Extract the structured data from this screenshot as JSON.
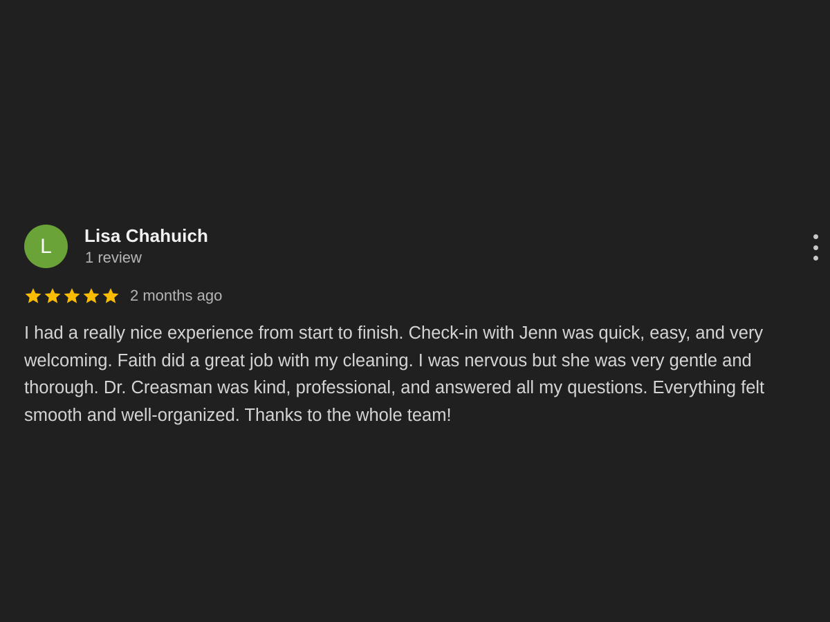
{
  "review": {
    "avatar": {
      "initial": "L",
      "color": "#6aa338"
    },
    "author_name": "Lisa Chahuich",
    "review_count": "1 review",
    "rating": 5,
    "rating_max": 5,
    "star_color": "#fbbc04",
    "star_icon": "star-icon",
    "time_ago": "2 months ago",
    "text": "I had a really nice experience from start to finish. Check-in with Jenn was quick, easy, and very welcoming. Faith did a great job with my cleaning. I was nervous but she was very gentle and thorough. Dr. Creasman was kind, professional, and answered all my questions. Everything felt smooth and well-organized. Thanks to the whole team!",
    "more_options_icon": "more-vert-icon"
  }
}
